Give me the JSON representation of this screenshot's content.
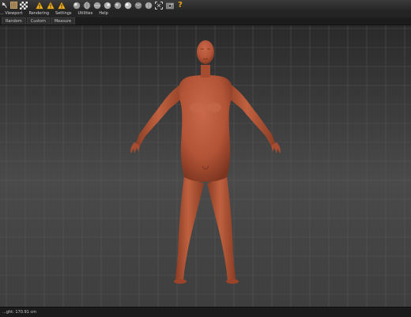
{
  "menu": {
    "items": [
      "... Viewport",
      "Rendering",
      "Settings",
      "Utilities",
      "Help"
    ]
  },
  "tabs": [
    "Random",
    "Custom",
    "Measure"
  ],
  "toolbar": {
    "icons": [
      "undo-icon",
      "grid-icon",
      "checker-icon",
      "warning-icon",
      "warning-icon",
      "warning-icon",
      "sphere-icon",
      "sphere-icon",
      "sphere-icon",
      "sphere-icon",
      "sphere-icon",
      "sphere-icon",
      "sphere-icon",
      "sphere-icon",
      "frame-icon",
      "camera-icon",
      "help-icon"
    ],
    "help_glyph": "?"
  },
  "statusbar": {
    "text": "...ght: 170.91 cm"
  },
  "colors": {
    "skin": "#b35437",
    "warning": "#f0b020",
    "help": "#e8a319"
  }
}
